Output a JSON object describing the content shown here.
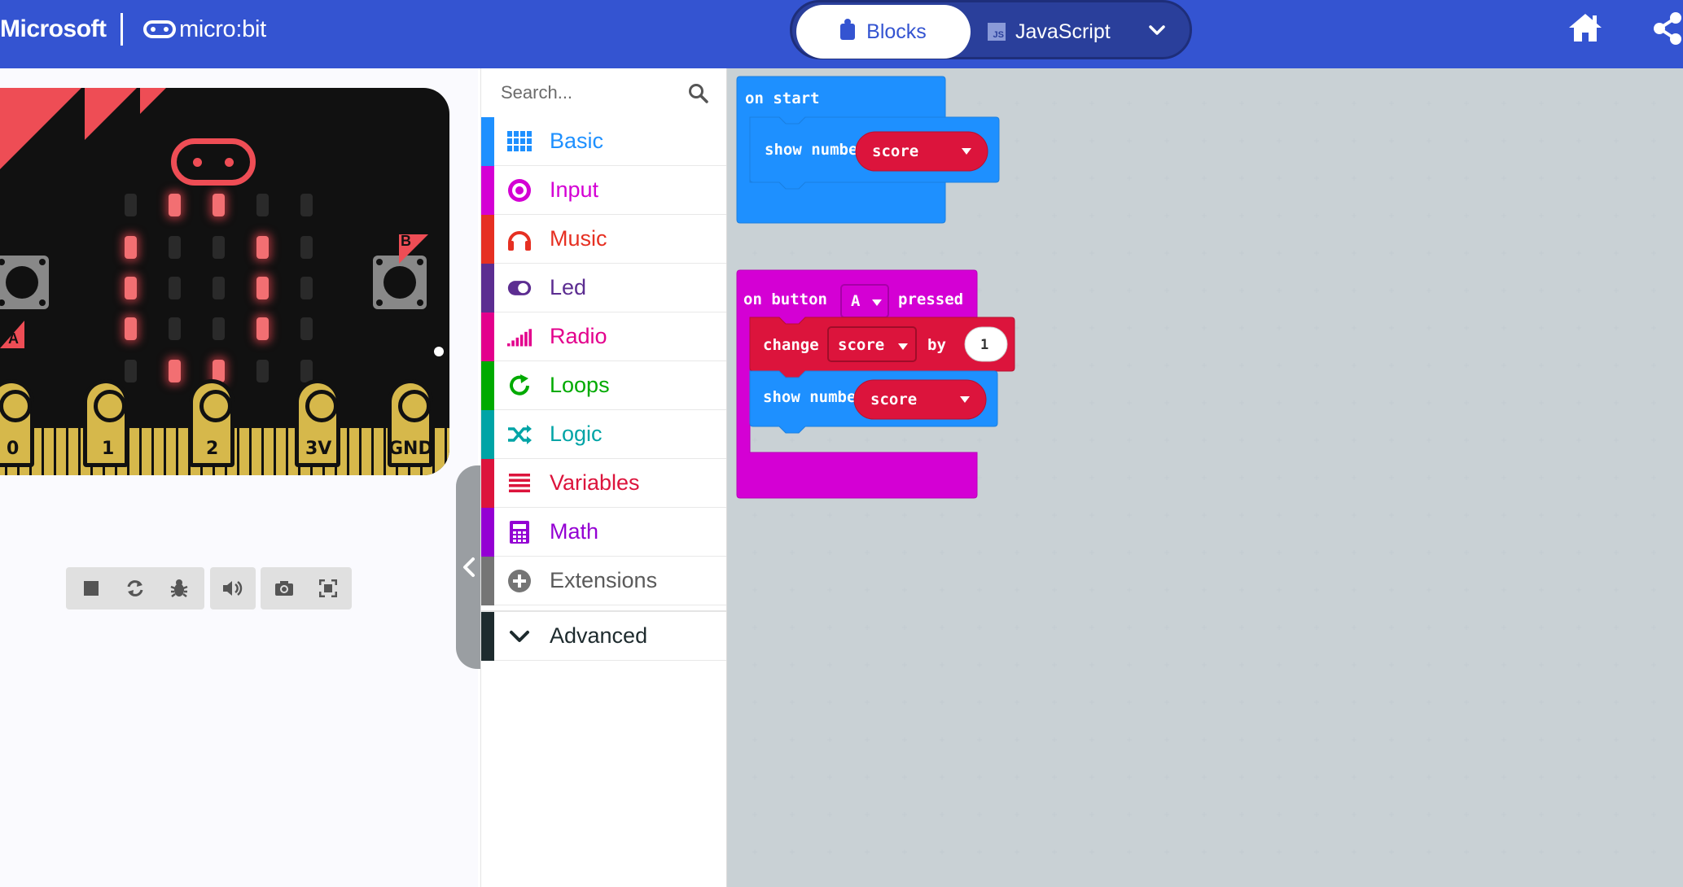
{
  "header": {
    "brand_microsoft": "Microsoft",
    "brand_microbit": "micro:bit",
    "tabs": {
      "blocks": "Blocks",
      "javascript": "JavaScript",
      "js_badge": "JS"
    },
    "icons": [
      "home-icon",
      "share-icon",
      "chevron-down-icon",
      "puzzle-icon"
    ]
  },
  "simulator": {
    "pins": [
      "0",
      "1",
      "2",
      "3V",
      "GND"
    ],
    "button_a": "A",
    "button_b": "B",
    "led_matrix": [
      [
        0,
        1,
        1,
        0,
        0
      ],
      [
        1,
        0,
        0,
        1,
        0
      ],
      [
        1,
        0,
        0,
        1,
        0
      ],
      [
        1,
        0,
        0,
        1,
        0
      ],
      [
        0,
        1,
        1,
        0,
        0
      ]
    ],
    "toolbar_icons": [
      "stop-icon",
      "restart-icon",
      "debug-icon",
      "mute-icon",
      "screenshot-icon",
      "fullscreen-icon"
    ]
  },
  "toolbox": {
    "search_placeholder": "Search...",
    "categories": [
      {
        "label": "Basic",
        "color": "#1e90ff"
      },
      {
        "label": "Input",
        "color": "#d400d4"
      },
      {
        "label": "Music",
        "color": "#e63022"
      },
      {
        "label": "Led",
        "color": "#5c2d91"
      },
      {
        "label": "Radio",
        "color": "#e3008c"
      },
      {
        "label": "Loops",
        "color": "#00aa00"
      },
      {
        "label": "Logic",
        "color": "#00a4a6"
      },
      {
        "label": "Variables",
        "color": "#dc143c"
      },
      {
        "label": "Math",
        "color": "#9400d3"
      },
      {
        "label": "Extensions",
        "color": "#757575"
      },
      {
        "label": "Advanced",
        "color": "#1e2b2e"
      }
    ]
  },
  "workspace": {
    "on_start": {
      "label": "on start",
      "child": {
        "label": "show number",
        "value": "score"
      }
    },
    "on_button": {
      "label_prefix": "on button",
      "button": "A",
      "label_suffix": "pressed",
      "children": [
        {
          "label": "change",
          "variable": "score",
          "by_label": "by",
          "amount": "1"
        },
        {
          "label": "show number",
          "value": "score"
        }
      ]
    },
    "colors": {
      "basic": "#1e90ff",
      "input": "#d400d4",
      "variables": "#dc143c"
    }
  }
}
